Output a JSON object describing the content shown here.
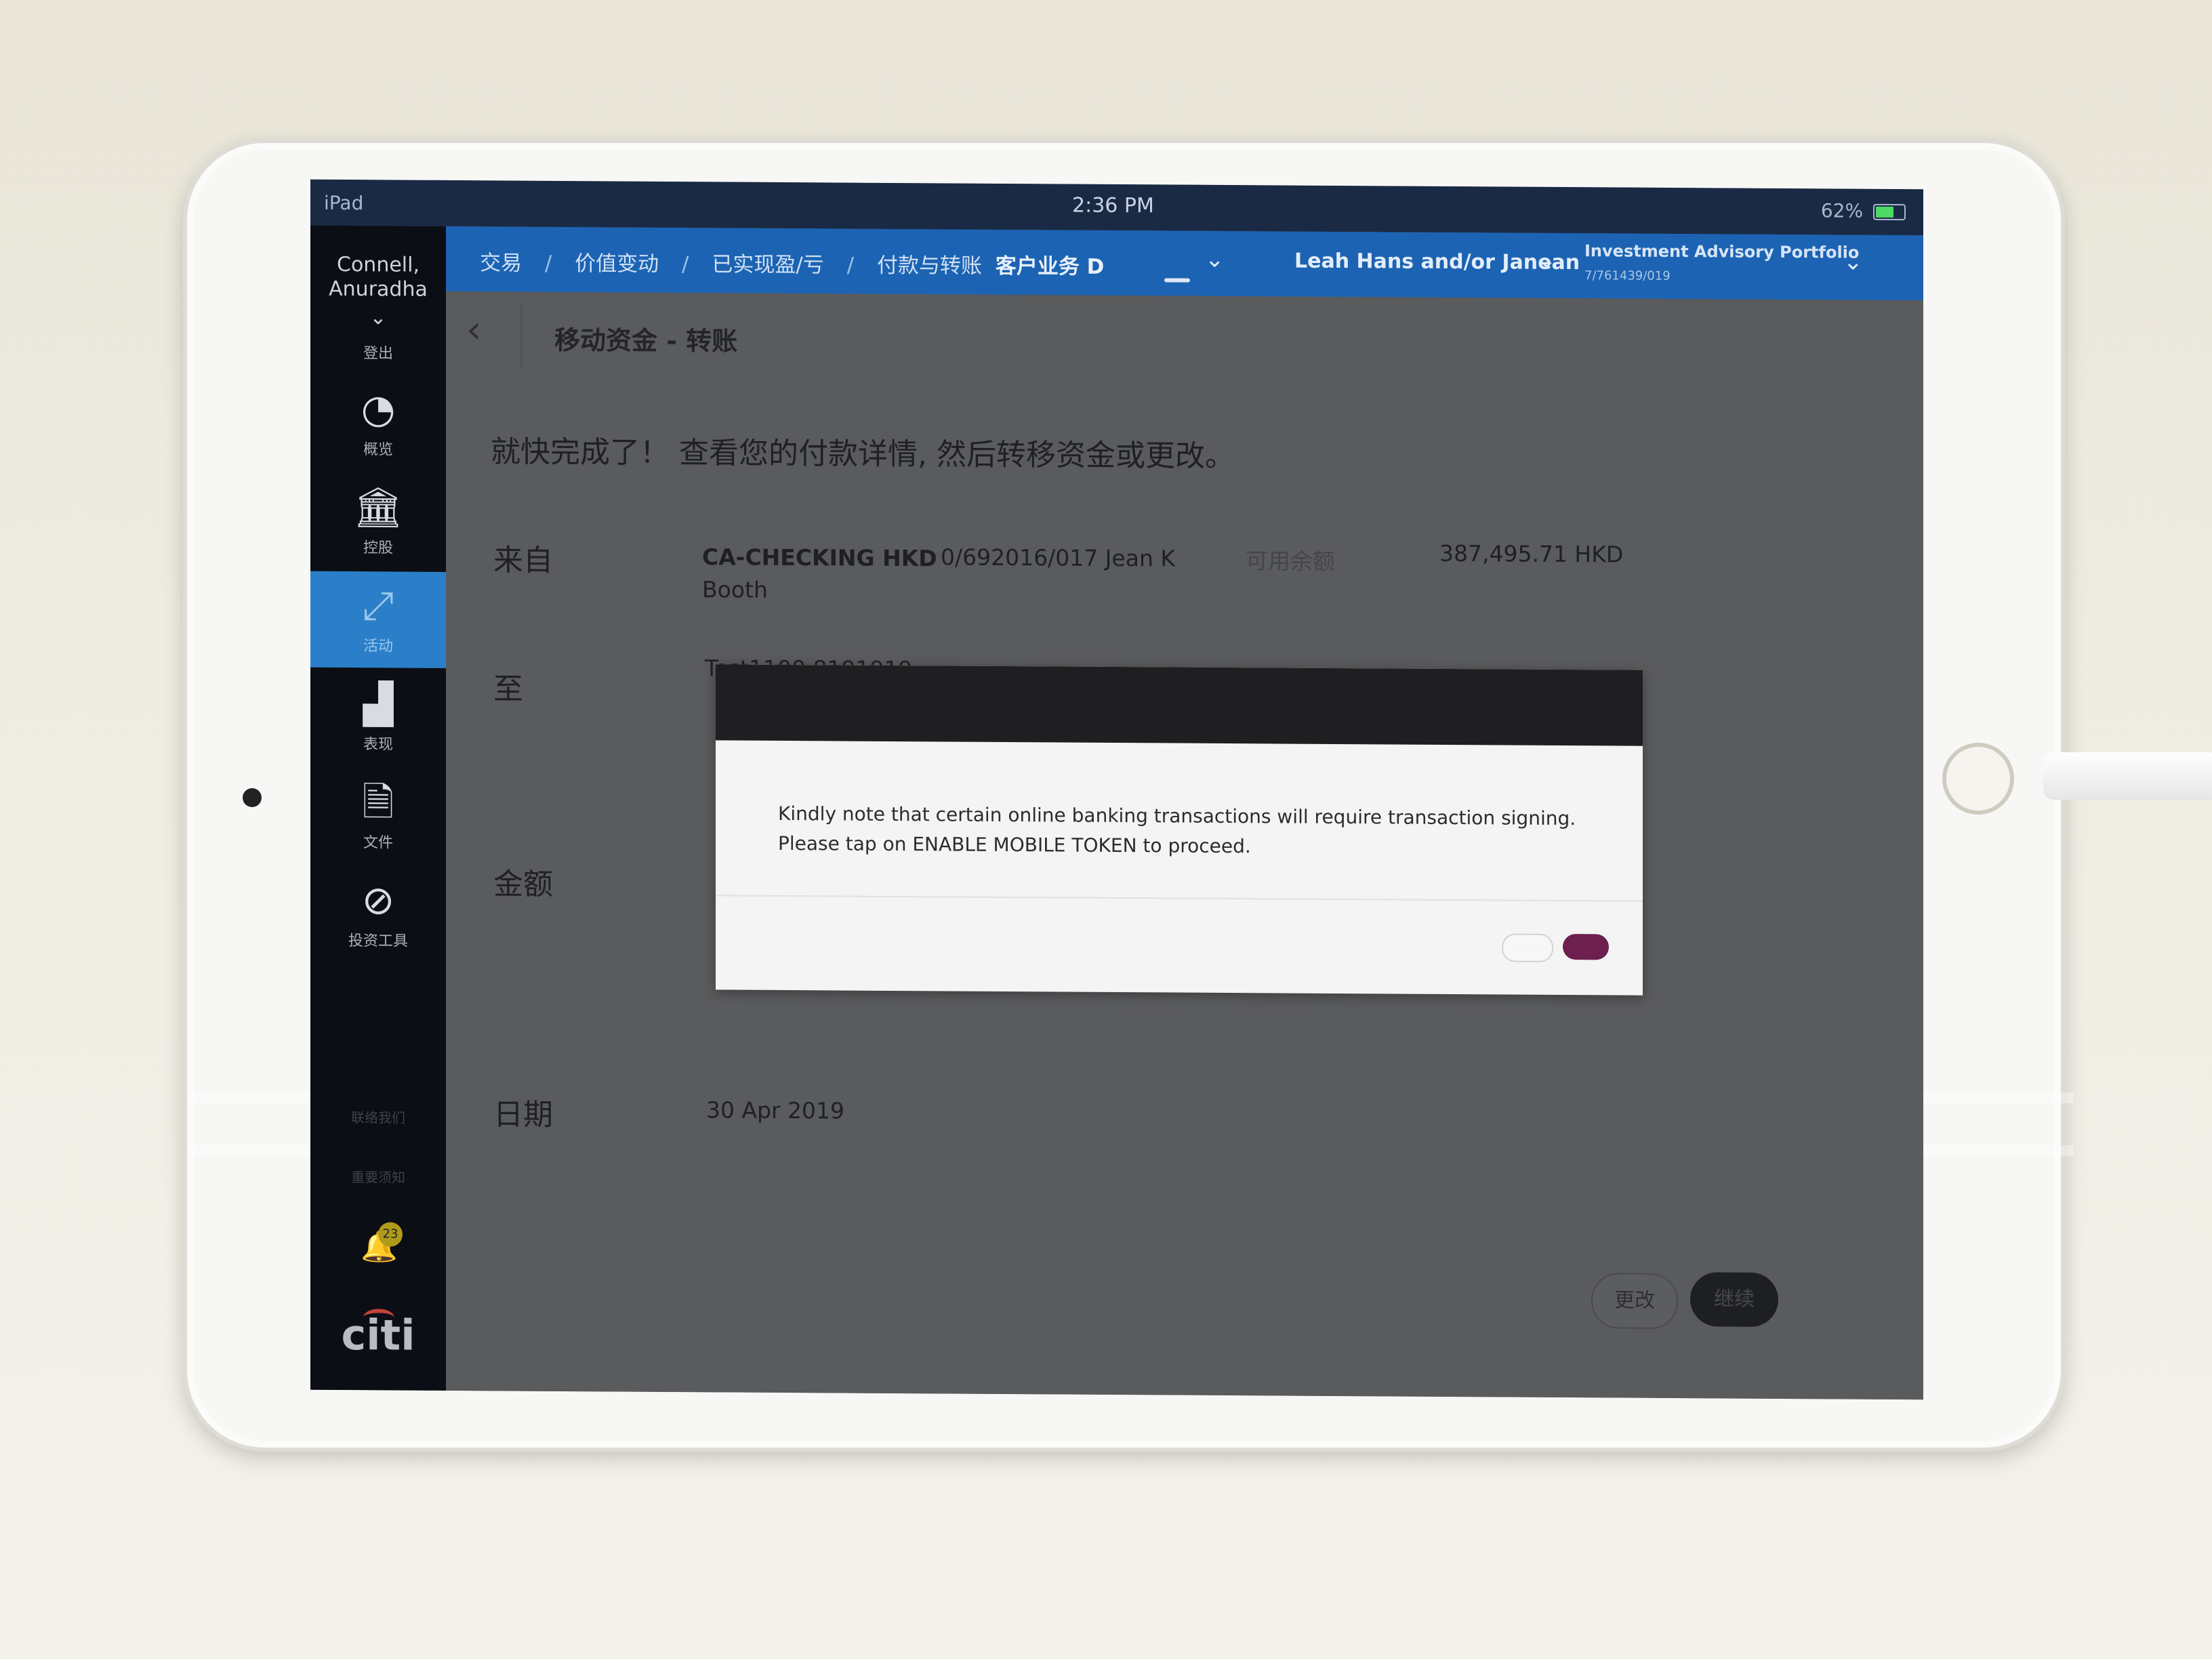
{
  "status_bar": {
    "device": "iPad",
    "time": "2:36 PM",
    "battery": "62%"
  },
  "sidebar": {
    "user_name": "Connell, Anuradha",
    "logout_label": "登出",
    "items": [
      {
        "label": "概览",
        "icon": "gauge-icon"
      },
      {
        "label": "控股",
        "icon": "bank-icon"
      },
      {
        "label": "活动",
        "icon": "transfer-arrows-icon",
        "active": true
      },
      {
        "label": "表现",
        "icon": "bar-chart-icon"
      },
      {
        "label": "文件",
        "icon": "document-lock-icon"
      },
      {
        "label": "投资工具",
        "icon": "compass-icon"
      }
    ],
    "contact_us": "联络我们",
    "notices": "重要须知",
    "notification_count": "23",
    "logo": "citi"
  },
  "topnav": {
    "breadcrumbs": [
      "交易",
      "价值变动",
      "已实现盈/亏",
      "付款与转账"
    ],
    "separator": "/",
    "current_client": "客户业务 D",
    "client_selector": "Leah  Hans and/or Janean",
    "portfolio_name": "Investment Advisory Portfolio",
    "portfolio_account": "7/761439/019"
  },
  "page": {
    "title": "移动资金 - 转账",
    "intro": "就快完成了！ 查看您的付款详情, 然后转移资金或更改。",
    "from_label": "来自",
    "from_account_name": "CA-CHECKING HKD",
    "from_account_number": "0/692016/017 Jean K",
    "from_account_owner": "Booth",
    "available_balance_label": "可用余额",
    "available_balance": "387,495.71 HKD",
    "to_label": "至",
    "to_account": "Test1100 8191919",
    "amount_label": "金额",
    "date_label": "日期",
    "date_value": "30 Apr 2019",
    "change_button": "更改",
    "continue_button": "继续"
  },
  "dialog": {
    "message_line1": "Kindly note that certain online banking transactions will require transaction signing.",
    "message_line2": "Please tap on ENABLE MOBILE TOKEN to proceed.",
    "ok_color": "#6d1f4e"
  }
}
